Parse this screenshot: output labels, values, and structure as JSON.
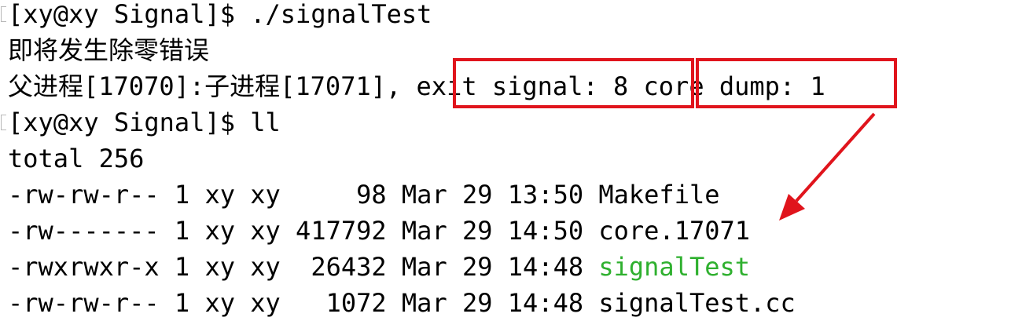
{
  "terminal": {
    "lines": [
      "[xy@xy Signal]$ ./signalTest",
      "即将发生除零错误",
      "父进程[17070]:子进程[17071], ",
      "[xy@xy Signal]$ ll",
      "total 256",
      "-rw-rw-r-- 1 xy xy     98 Mar 29 13:50 Makefile",
      "-rw------- 1 xy xy 417792 Mar 29 14:50 core.17071",
      "-rwxrwxr-x 1 xy xy  26432 Mar 29 14:48 ",
      "-rw-rw-r-- 1 xy xy   1072 Mar 29 14:48 signalTest.cc"
    ],
    "exit_signal": "exit signal: 8",
    "core_dump": "core dump: 1",
    "executable_name": "signalTest",
    "executable_color": "#2fb02f"
  },
  "annotations": {
    "box_color": "#e0141c",
    "arrow_color": "#e0141c"
  }
}
